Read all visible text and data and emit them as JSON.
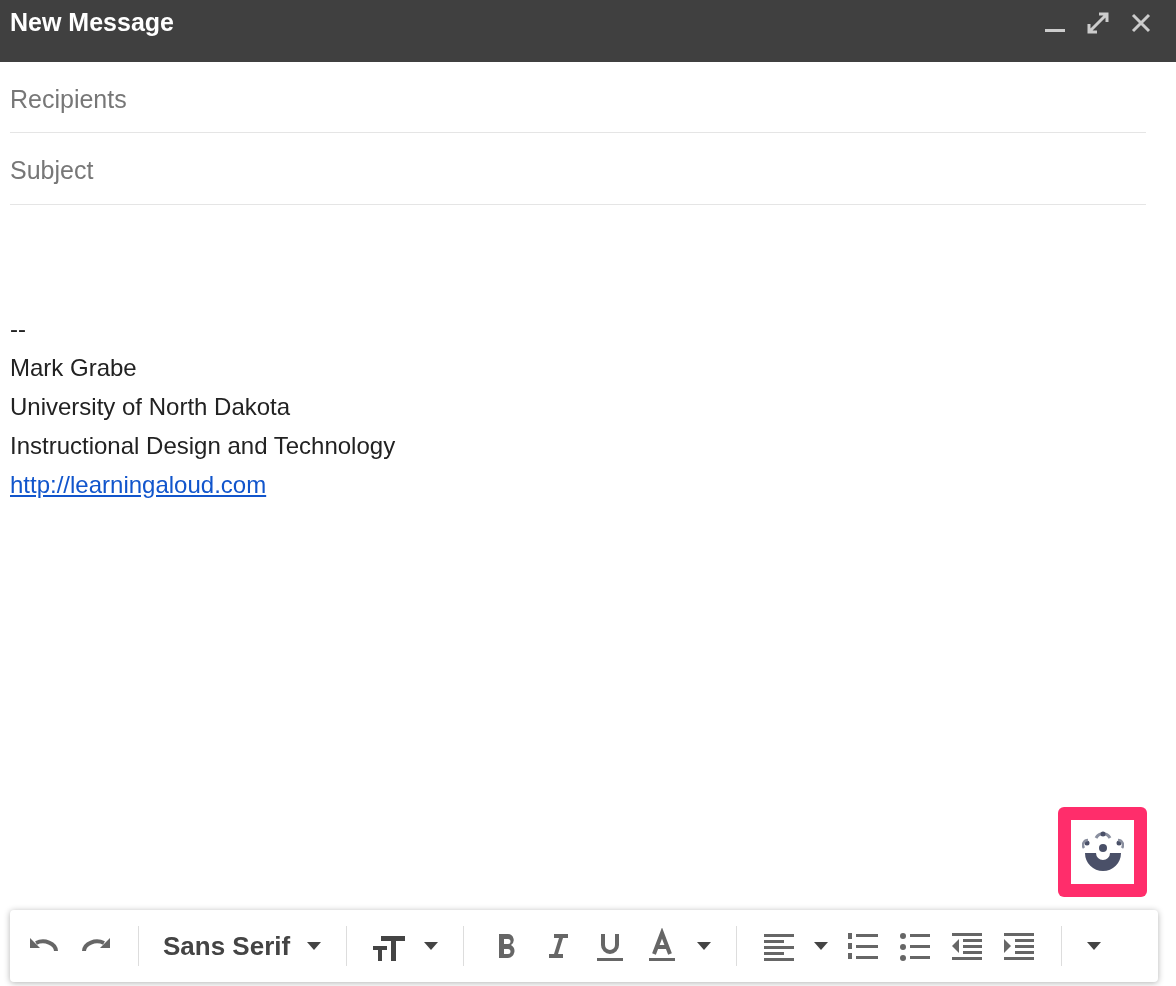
{
  "window": {
    "title": "New Message"
  },
  "recipients": {
    "placeholder": "Recipients"
  },
  "subject": {
    "placeholder": "Subject"
  },
  "body": [
    {
      "kind": "text",
      "text": "--"
    },
    {
      "kind": "text",
      "text": "Mark Grabe"
    },
    {
      "kind": "text",
      "text": "University of North Dakota"
    },
    {
      "kind": "text",
      "text": "Instructional Design and Technology"
    },
    {
      "kind": "link",
      "text": "http://learningaloud.com"
    }
  ],
  "toolbar": {
    "font": "Sans Serif"
  }
}
